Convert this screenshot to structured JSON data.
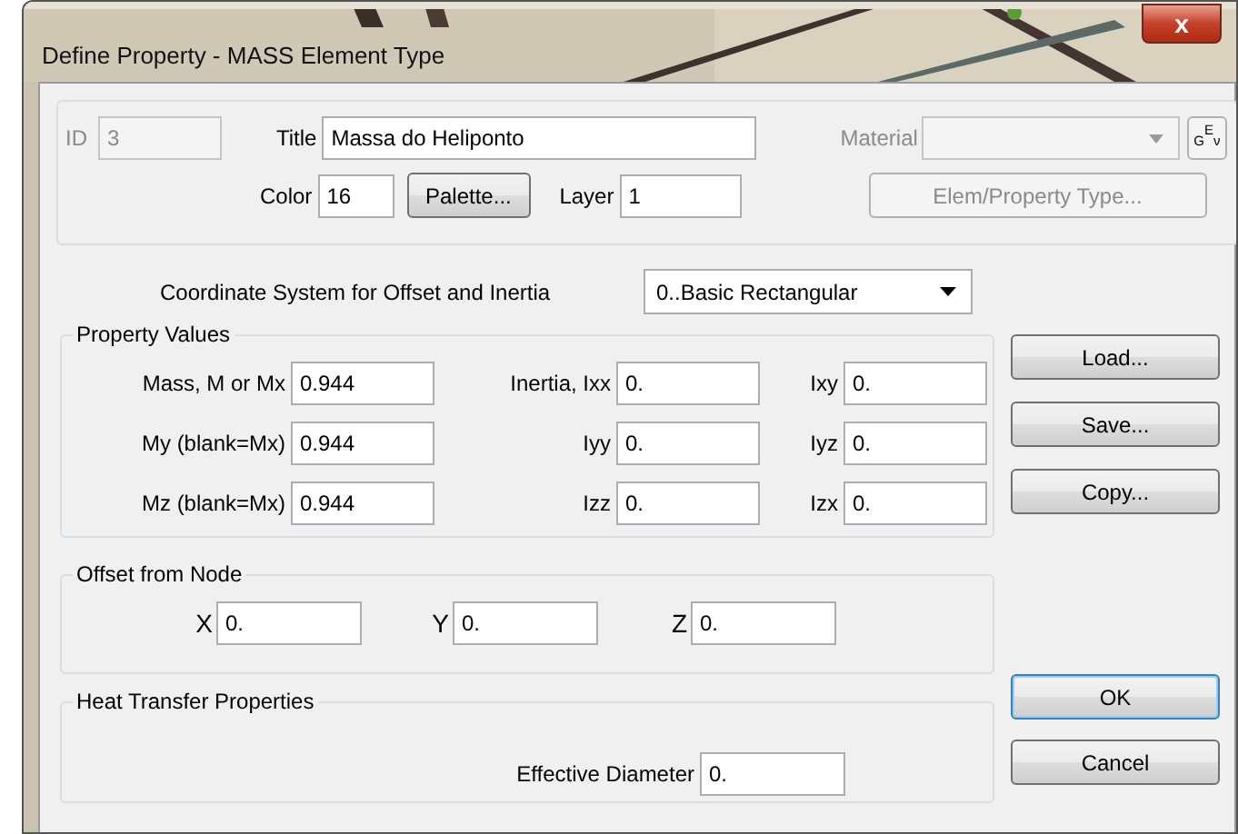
{
  "window": {
    "title": "Define Property - MASS Element Type",
    "close": "x"
  },
  "header": {
    "id": {
      "label": "ID",
      "value": "3",
      "disabled": true
    },
    "title": {
      "label": "Title",
      "value": "Massa do Heliponto"
    },
    "material": {
      "label": "Material",
      "disabled": true
    },
    "material_button": {
      "label": "$_{G}$$^{E}$$_{ν}$"
    },
    "color": {
      "label": "Color",
      "value": "16"
    },
    "palette_button": {
      "label": "Palette..."
    },
    "layer": {
      "label": "Layer",
      "value": "1"
    },
    "type_button": {
      "label": "Elem/Property Type...",
      "disabled": true
    }
  },
  "coordinate_system": {
    "label": "Coordinate System for Offset and Inertia",
    "value": "0..Basic Rectangular"
  },
  "property_values": {
    "title": "Property Values",
    "rows": [
      [
        {
          "label": "Mass,  M or Mx",
          "value": "0.944"
        },
        {
          "label": "Inertia,  Ixx",
          "value": "0."
        },
        {
          "label": "Ixy",
          "value": "0."
        }
      ],
      [
        {
          "label": "My (blank=Mx)",
          "value": "0.944"
        },
        {
          "label": "Iyy",
          "value": "0."
        },
        {
          "label": "Iyz",
          "value": "0."
        }
      ],
      [
        {
          "label": "Mz (blank=Mx)",
          "value": "0.944"
        },
        {
          "label": "Izz",
          "value": "0."
        },
        {
          "label": "Izx",
          "value": "0."
        }
      ]
    ]
  },
  "offset": {
    "title": "Offset from Node",
    "fields": [
      {
        "label": "X",
        "value": "0."
      },
      {
        "label": "Y",
        "value": "0."
      },
      {
        "label": "Z",
        "value": "0."
      }
    ]
  },
  "heat_transfer": {
    "title": "Heat Transfer Properties",
    "field": {
      "label": "Effective Diameter",
      "value": "0."
    }
  },
  "side_buttons": [
    {
      "label": "Load...",
      "default": false
    },
    {
      "label": "Save...",
      "default": false
    },
    {
      "label": "Copy...",
      "default": false
    }
  ],
  "bottom_buttons": [
    {
      "label": "OK",
      "default": true
    },
    {
      "label": "Cancel",
      "default": false
    }
  ]
}
